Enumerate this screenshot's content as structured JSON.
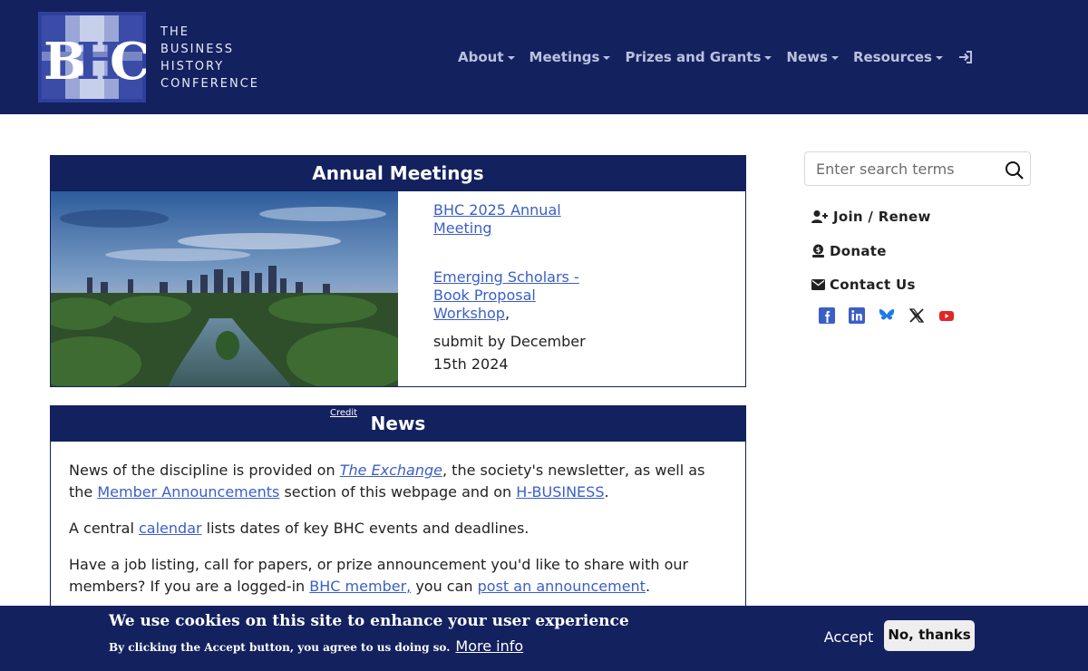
{
  "brand": {
    "logo_letters": "BHC",
    "line1": "THE",
    "line2": "BUSINESS",
    "line3": "HISTORY",
    "line4": "CONFERENCE"
  },
  "nav": {
    "items": [
      {
        "label": "About"
      },
      {
        "label": "Meetings"
      },
      {
        "label": "Prizes and Grants"
      },
      {
        "label": "News"
      },
      {
        "label": "Resources"
      }
    ],
    "login_icon": "sign-in-icon"
  },
  "meetings": {
    "title": "Annual Meetings",
    "link1": "BHC 2025 Annual Meeting ",
    "link2": "Emerging Scholars - Book Proposal Workshop",
    "link2_suffix": ",",
    "submit_text": "submit by December 15th 2024"
  },
  "news": {
    "title": "News",
    "credit": "Credit",
    "p1_pre": "News of the discipline is provided on ",
    "p1_link1": "The Exchange",
    "p1_mid": ", the society's newsletter, as well as the ",
    "p1_link2": "Member Announcements",
    "p1_mid2": " section of this webpage and on ",
    "p1_link3": "H-BUSINESS",
    "p1_end": ".",
    "p2_pre": "A central ",
    "p2_link": "calendar",
    "p2_end": " lists dates of key BHC events and deadlines.",
    "p3_pre": "Have a job listing, call for papers, or prize announcement you'd like to share with our members? If you are a logged-in ",
    "p3_link1": "BHC member,",
    "p3_mid": " you can ",
    "p3_link2": "post an announcement",
    "p3_end": "."
  },
  "sidebar": {
    "search_placeholder": "Enter search terms",
    "join": "Join / Renew",
    "donate": "Donate",
    "contact": "Contact Us",
    "social": [
      "facebook-icon",
      "linkedin-icon",
      "bluesky-icon",
      "x-icon",
      "youtube-icon"
    ]
  },
  "cookie": {
    "title": "We use cookies on this site to enhance your user experience",
    "sub": "By clicking the Accept button, you agree to us doing so.",
    "more_info": "More info",
    "accept": "Accept",
    "no_thanks": "No, thanks"
  },
  "colors": {
    "navy": "#13215f",
    "link": "#3b5fc6",
    "nav_text": "#b9c2dc"
  }
}
